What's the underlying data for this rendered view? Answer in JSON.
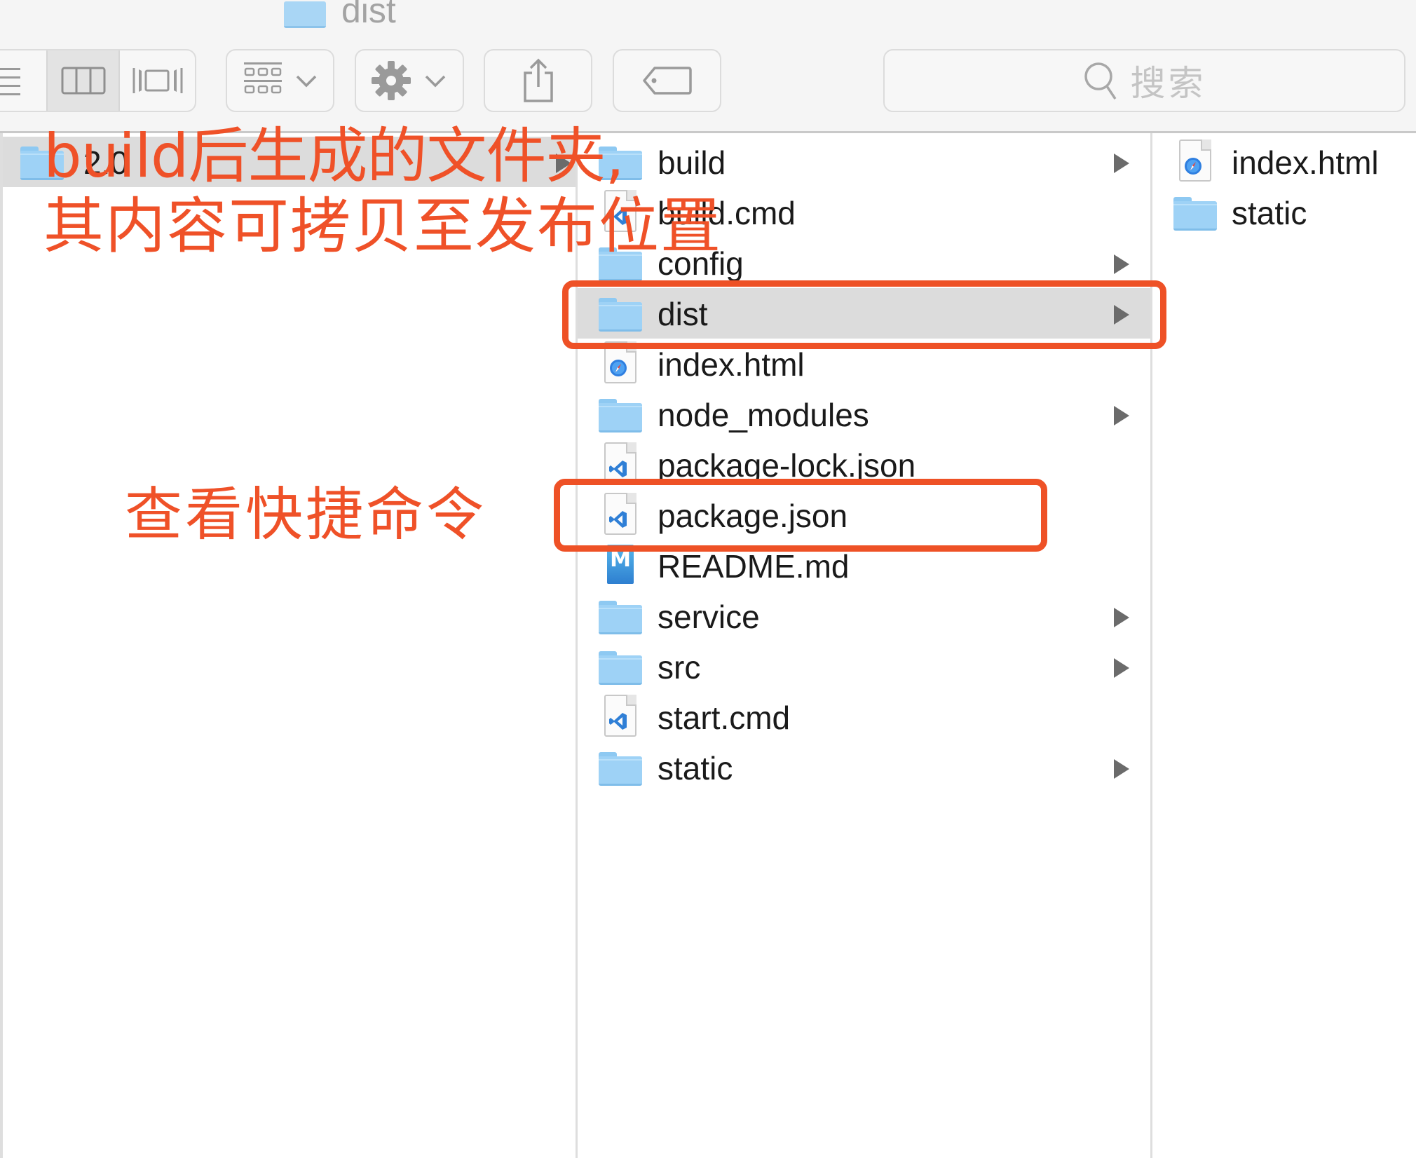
{
  "window": {
    "title": "dist",
    "title_icon": "folder-icon"
  },
  "toolbar": {
    "view_modes": [
      {
        "name": "list",
        "icon": "list-view-icon",
        "active": false
      },
      {
        "name": "columns",
        "icon": "column-view-icon",
        "active": true
      },
      {
        "name": "cover-flow",
        "icon": "cover-flow-icon",
        "active": false
      }
    ],
    "arrange_icon": "arrange-grid-icon",
    "action_icon": "gear-icon",
    "share_icon": "share-icon",
    "tags_icon": "tag-icon",
    "search": {
      "placeholder": "搜索",
      "value": "",
      "icon": "search-icon"
    }
  },
  "columns": [
    {
      "items": [
        {
          "name": "2.0",
          "type": "folder",
          "has_children": true,
          "selected": true
        }
      ]
    },
    {
      "items": [
        {
          "name": "build",
          "type": "folder",
          "has_children": true,
          "selected": false
        },
        {
          "name": "build.cmd",
          "type": "vscode-file",
          "has_children": false,
          "selected": false
        },
        {
          "name": "config",
          "type": "folder",
          "has_children": true,
          "selected": false
        },
        {
          "name": "dist",
          "type": "folder",
          "has_children": true,
          "selected": true
        },
        {
          "name": "index.html",
          "type": "safari-html",
          "has_children": false,
          "selected": false
        },
        {
          "name": "node_modules",
          "type": "folder",
          "has_children": true,
          "selected": false
        },
        {
          "name": "package-lock.json",
          "type": "vscode-file",
          "has_children": false,
          "selected": false
        },
        {
          "name": "package.json",
          "type": "vscode-file",
          "has_children": false,
          "selected": false
        },
        {
          "name": "README.md",
          "type": "markdown",
          "has_children": false,
          "selected": false
        },
        {
          "name": "service",
          "type": "folder",
          "has_children": true,
          "selected": false
        },
        {
          "name": "src",
          "type": "folder",
          "has_children": true,
          "selected": false
        },
        {
          "name": "start.cmd",
          "type": "vscode-file",
          "has_children": false,
          "selected": false
        },
        {
          "name": "static",
          "type": "folder",
          "has_children": true,
          "selected": false
        }
      ]
    },
    {
      "items": [
        {
          "name": "index.html",
          "type": "safari-html",
          "has_children": false,
          "selected": false
        },
        {
          "name": "static",
          "type": "folder",
          "has_children": false,
          "selected": false
        }
      ]
    }
  ],
  "annotations": {
    "line1": "build后生成的文件夹,",
    "line2": "其内容可拷贝至发布位置",
    "shortcut_note": "查看快捷命令",
    "highlight_color": "#ee5126"
  },
  "colors": {
    "selection_gray": "#dcdcdc",
    "folder_blue": "#9ed2f6",
    "toolbar_bg": "#f5f5f5"
  }
}
